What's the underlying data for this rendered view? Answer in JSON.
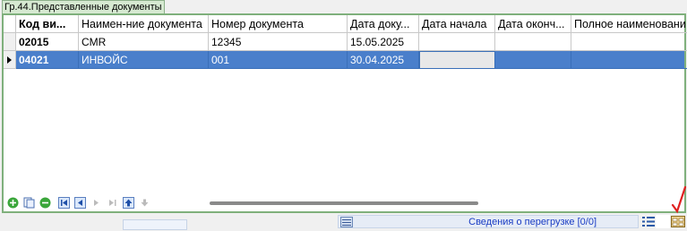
{
  "tab": {
    "label": "Гр.44.Представленные документы"
  },
  "columns": [
    {
      "label": "Код ви...",
      "bold": true
    },
    {
      "label": "Наимен-ние документа",
      "bold": false
    },
    {
      "label": "Номер документа",
      "bold": false
    },
    {
      "label": "Дата доку...",
      "bold": false
    },
    {
      "label": "Дата начала",
      "bold": false
    },
    {
      "label": "Дата оконч...",
      "bold": false
    },
    {
      "label": "Полное наименовани",
      "bold": false
    }
  ],
  "rows": [
    {
      "selected": false,
      "cells": [
        "02015",
        "CMR",
        "12345",
        "15.05.2025",
        "",
        "",
        ""
      ]
    },
    {
      "selected": true,
      "cells": [
        "04021",
        "ИНВОЙС",
        "001",
        "30.04.2025",
        "",
        "",
        ""
      ]
    }
  ],
  "toolbar": {
    "buttons": [
      "add-icon",
      "copy-icon",
      "delete-icon",
      "first-icon",
      "prev-icon",
      "next-icon",
      "last-icon",
      "up-icon",
      "down-icon"
    ]
  },
  "status": {
    "text": "Сведения о перегрузке [0/0]"
  },
  "colors": {
    "selection": "#4a7fcb",
    "frame": "#7fb07c",
    "tab": "#d6e9d1",
    "status_text": "#1a3cc4",
    "checkmark": "#e02020"
  }
}
